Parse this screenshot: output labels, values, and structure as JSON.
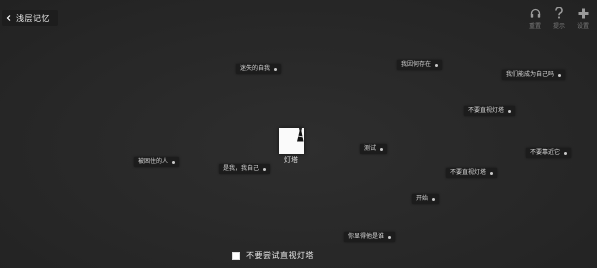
{
  "header": {
    "title": "浅层记忆",
    "back_icon": "chevron-left-icon"
  },
  "toolbar": {
    "reset_label": "重置",
    "hint_label": "提示",
    "settings_label": "设置",
    "reset_icon": "headphones-icon",
    "hint_icon": "question-icon",
    "settings_icon": "plus-icon"
  },
  "tags": [
    {
      "id": "lost-self",
      "label": "迷失的自我"
    },
    {
      "id": "what-i-keep",
      "label": "我因何存在"
    },
    {
      "id": "can-we-become",
      "label": "我们能成为自己吗"
    },
    {
      "id": "dont-look-lighthouse",
      "label": "不要直视灯塔"
    },
    {
      "id": "trapped-person",
      "label": "被困住的人"
    },
    {
      "id": "test",
      "label": "测试"
    },
    {
      "id": "dont-approach",
      "label": "不要靠近它"
    },
    {
      "id": "its-me",
      "label": "是我，我自己"
    },
    {
      "id": "dont-look-lighthouse-2",
      "label": "不要直视灯塔"
    },
    {
      "id": "start",
      "label": "开始"
    },
    {
      "id": "you-remember",
      "label": "你显得他是谁"
    }
  ],
  "center": {
    "lamp_label": "灯塔",
    "lamp_icon": "lighthouse-icon"
  },
  "footer": {
    "checkbox_label": "不要尝试直视灯塔",
    "checked": false
  },
  "colors": {
    "background": "#2a2a2a",
    "tag_bg": "#1c1c1c",
    "text": "#e6e6e6",
    "muted": "#7a7a7a"
  }
}
